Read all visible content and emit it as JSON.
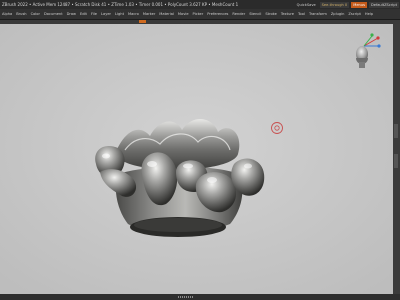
{
  "window": {
    "title": "ZBrush 2022 • Active Mem 12487 • Scratch Disk 41 • ZTime 1.03 • Timer 0.001 • PolyCount 3.627 KP • MeshCount 1"
  },
  "titlebar_buttons": {
    "quicksave": "QuickSave",
    "see_through": "See-through 0",
    "menus": "Menus",
    "default_zscript": "DefaultZScript"
  },
  "menu_items": [
    "Alpha",
    "Brush",
    "Color",
    "Document",
    "Draw",
    "Edit",
    "File",
    "Layer",
    "Light",
    "Macro",
    "Marker",
    "Material",
    "Movie",
    "Picker",
    "Preferences",
    "Render",
    "Stencil",
    "Stroke",
    "Texture",
    "Tool",
    "Transform",
    "Zplugin",
    "Zscript",
    "Help"
  ],
  "colors": {
    "accent": "#d06a1f",
    "viewport_bg": "#c9c9c9",
    "ui_dark": "#2b2b2b"
  },
  "icons": {
    "navigation_gizmo": "head-orientation-gizmo",
    "cursor": "brush-cursor-circle"
  }
}
